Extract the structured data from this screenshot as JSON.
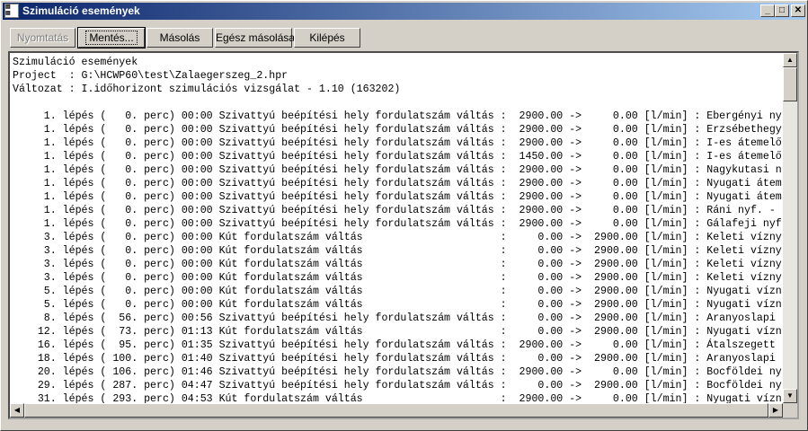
{
  "window": {
    "title": "Szimuláció események",
    "icon": "app-icon"
  },
  "caption_buttons": {
    "minimize": "_",
    "maximize": "□",
    "close": "✕"
  },
  "toolbar": {
    "print": "Nyomtatás",
    "save": "Mentés...",
    "copy": "Másolás",
    "copy_all": "Egész másolása",
    "exit": "Kilépés"
  },
  "report": {
    "lines": [
      "Szimuláció események",
      "Project  : G:\\HCWP60\\test\\Zalaegerszeg_2.hpr",
      "Változat : I.időhorizont szimulációs vizsgálat - 1.10 (163202)",
      "",
      "     1. lépés (   0. perc) 00:00 Szivattyú beépítési hely fordulatszám váltás :  2900.00 ->     0.00 [l/min] : Ebergényi ny",
      "     1. lépés (   0. perc) 00:00 Szivattyú beépítési hely fordulatszám váltás :  2900.00 ->     0.00 [l/min] : Erzsébethegy",
      "     1. lépés (   0. perc) 00:00 Szivattyú beépítési hely fordulatszám váltás :  2900.00 ->     0.00 [l/min] : I-es átemelő",
      "     1. lépés (   0. perc) 00:00 Szivattyú beépítési hely fordulatszám váltás :  1450.00 ->     0.00 [l/min] : I-es átemelő",
      "     1. lépés (   0. perc) 00:00 Szivattyú beépítési hely fordulatszám váltás :  2900.00 ->     0.00 [l/min] : Nagykutasi n",
      "     1. lépés (   0. perc) 00:00 Szivattyú beépítési hely fordulatszám váltás :  2900.00 ->     0.00 [l/min] : Nyugati átem",
      "     1. lépés (   0. perc) 00:00 Szivattyú beépítési hely fordulatszám váltás :  2900.00 ->     0.00 [l/min] : Nyugati átem",
      "     1. lépés (   0. perc) 00:00 Szivattyú beépítési hely fordulatszám váltás :  2900.00 ->     0.00 [l/min] : Ráni nyf. - ",
      "     1. lépés (   0. perc) 00:00 Szivattyú beépítési hely fordulatszám váltás :  2900.00 ->     0.00 [l/min] : Gálafeji nyf",
      "     3. lépés (   0. perc) 00:00 Kút fordulatszám váltás                      :     0.00 ->  2900.00 [l/min] : Keleti vízny",
      "     3. lépés (   0. perc) 00:00 Kút fordulatszám váltás                      :     0.00 ->  2900.00 [l/min] : Keleti vízny",
      "     3. lépés (   0. perc) 00:00 Kút fordulatszám váltás                      :     0.00 ->  2900.00 [l/min] : Keleti vízny",
      "     3. lépés (   0. perc) 00:00 Kút fordulatszám váltás                      :     0.00 ->  2900.00 [l/min] : Keleti vízny",
      "     5. lépés (   0. perc) 00:00 Kút fordulatszám váltás                      :     0.00 ->  2900.00 [l/min] : Nyugati vízn",
      "     5. lépés (   0. perc) 00:00 Kút fordulatszám váltás                      :     0.00 ->  2900.00 [l/min] : Nyugati vízn",
      "     8. lépés (  56. perc) 00:56 Szivattyú beépítési hely fordulatszám váltás :     0.00 ->  2900.00 [l/min] : Aranyoslapi ",
      "    12. lépés (  73. perc) 01:13 Kút fordulatszám váltás                      :     0.00 ->  2900.00 [l/min] : Nyugati vízn",
      "    16. lépés (  95. perc) 01:35 Szivattyú beépítési hely fordulatszám váltás :  2900.00 ->     0.00 [l/min] : Átalszegett ",
      "    18. lépés ( 100. perc) 01:40 Szivattyú beépítési hely fordulatszám váltás :     0.00 ->  2900.00 [l/min] : Aranyoslapi ",
      "    20. lépés ( 106. perc) 01:46 Szivattyú beépítési hely fordulatszám váltás :  2900.00 ->     0.00 [l/min] : Bocföldei ny",
      "    29. lépés ( 287. perc) 04:47 Szivattyú beépítési hely fordulatszám váltás :     0.00 ->  2900.00 [l/min] : Bocföldei ny",
      "    31. lépés ( 293. perc) 04:53 Kút fordulatszám váltás                      :  2900.00 ->     0.00 [l/min] : Nyugati vízn"
    ]
  },
  "scrollbars": {
    "up": "▲",
    "down": "▼",
    "left": "◀",
    "right": "▶"
  }
}
